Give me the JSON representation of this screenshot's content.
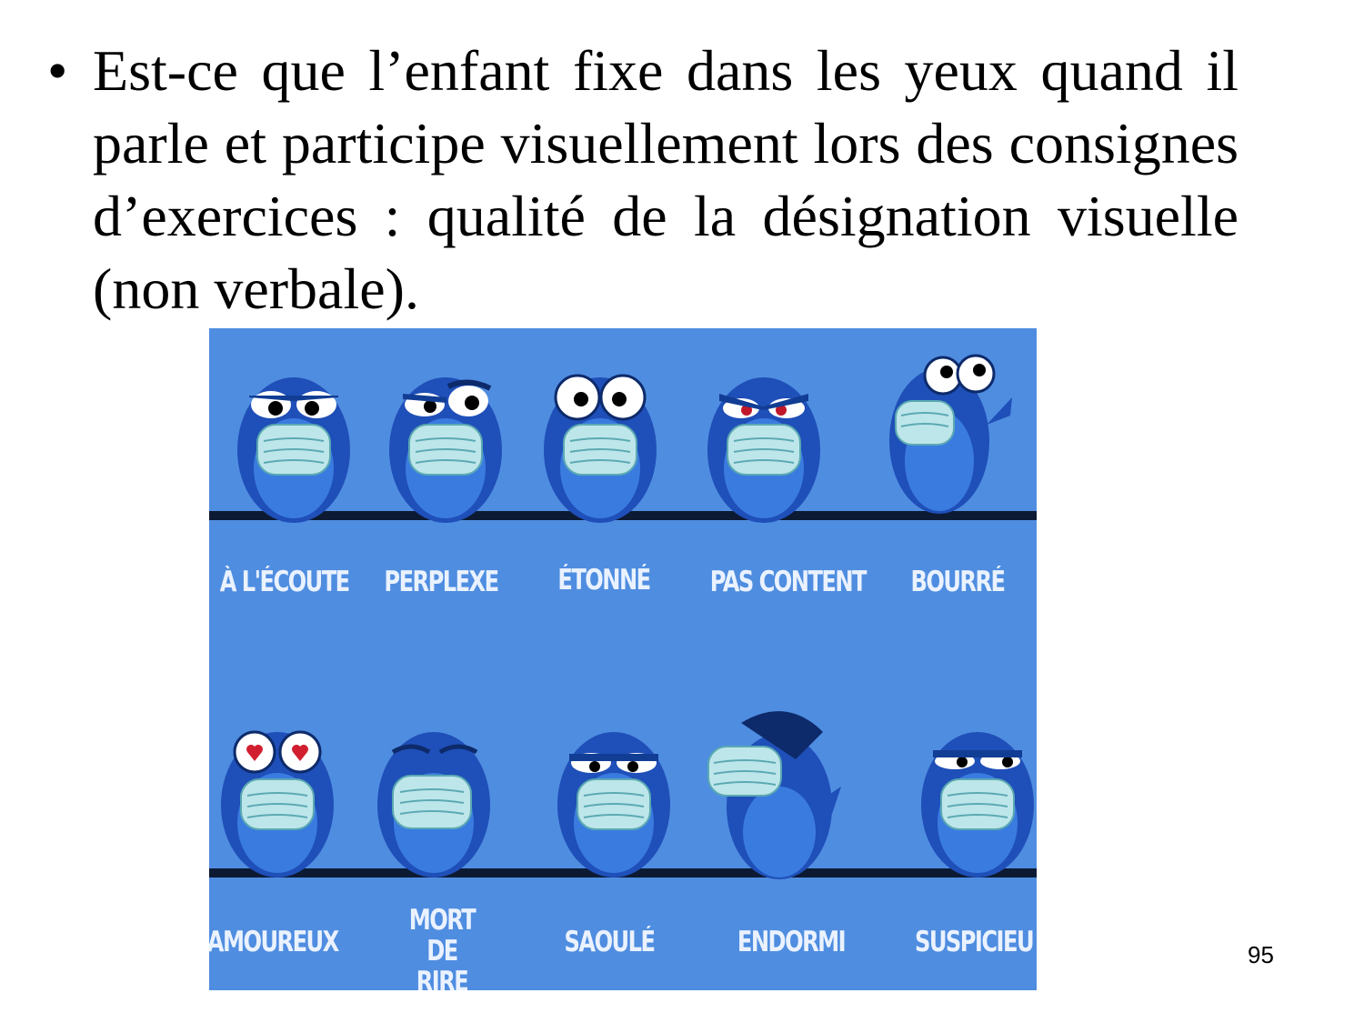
{
  "slide": {
    "bullet_text": "Est-ce que l’enfant fixe dans les yeux quand il parle et participe visuellement lors des consignes d’exercices : qualité de la désignation visuelle (non verbale).",
    "page_number": "95"
  },
  "illustration": {
    "background_color": "#4f8de0",
    "row1": [
      "À L'ÉCOUTE",
      "PERPLEXE",
      "ÉTONNÉ",
      "PAS CONTENT",
      "BOURRÉ"
    ],
    "row2": [
      "AMOUREUX",
      "MORT DE RIRE",
      "SAOULÉ",
      "ENDORMI",
      "SUSPICIEU"
    ]
  }
}
